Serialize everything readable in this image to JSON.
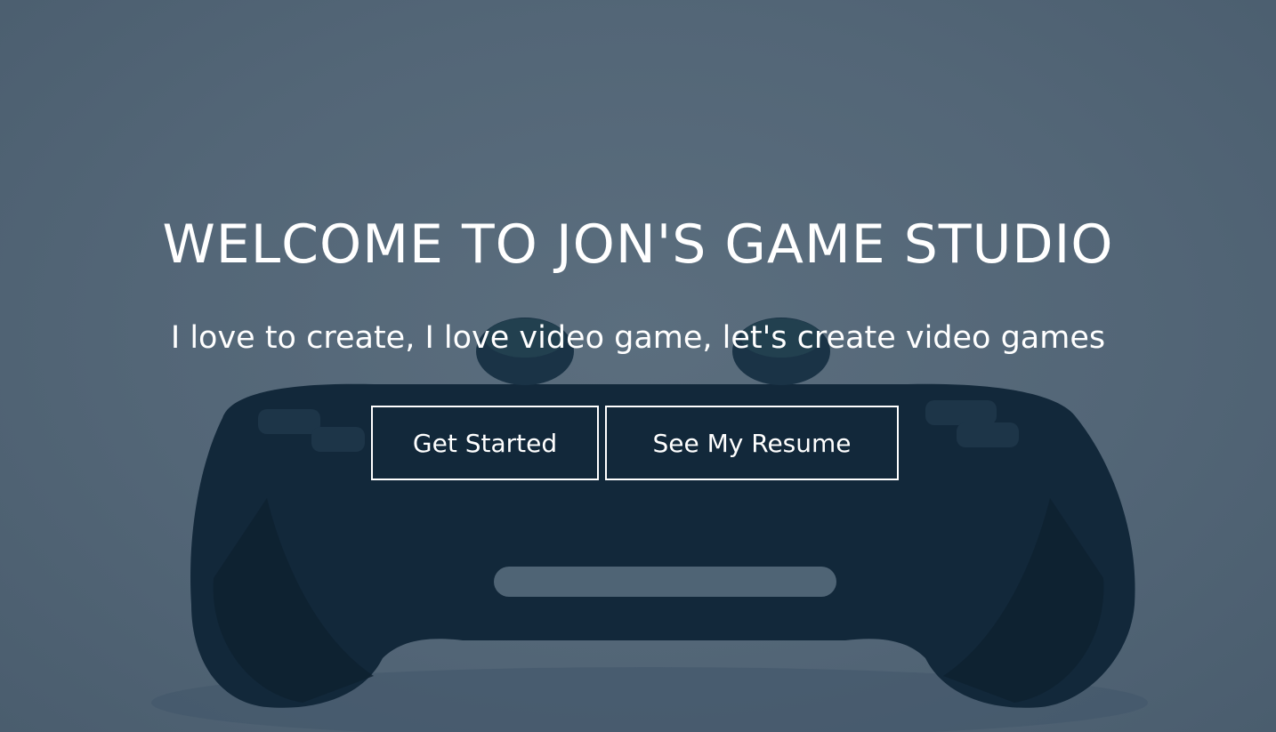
{
  "hero": {
    "title": "WELCOME TO JON'S GAME STUDIO",
    "subtitle": "I love to create, I love video game, let's create video games",
    "background_image": "game-controller-icon",
    "overlay_color": "#536677",
    "controller_color": "#12283a"
  },
  "buttons": {
    "get_started": "Get Started",
    "see_resume": "See My Resume"
  }
}
